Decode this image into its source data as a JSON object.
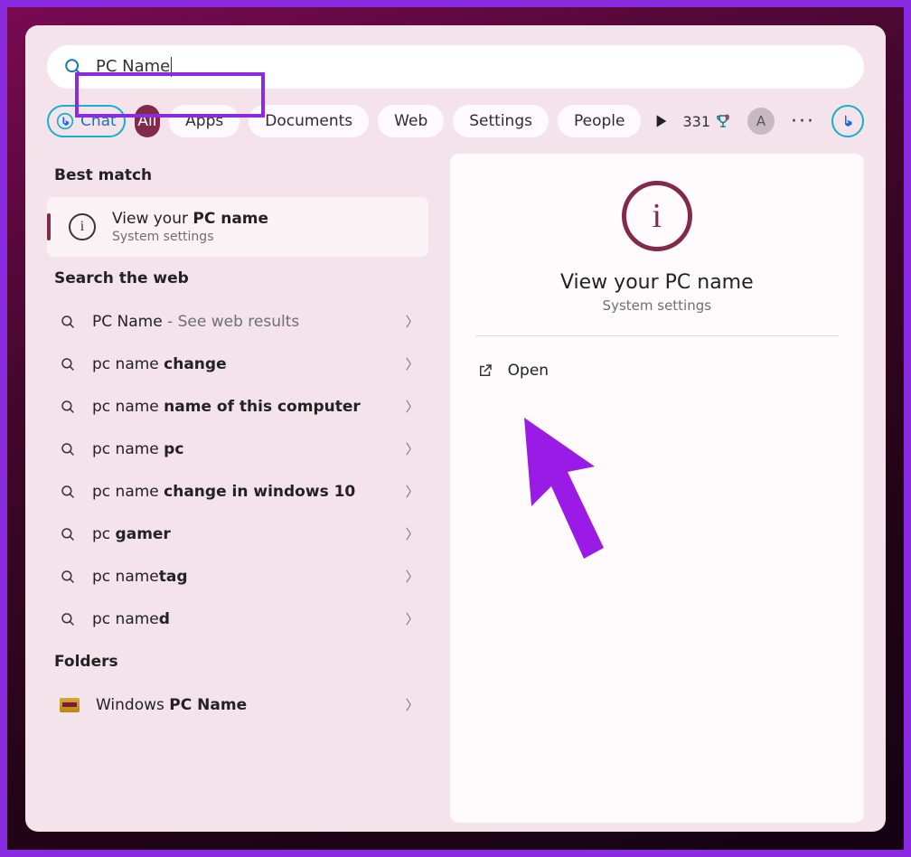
{
  "search": {
    "query": "PC Name"
  },
  "chips": {
    "chat": {
      "label": "Chat"
    },
    "all": {
      "label": "All"
    },
    "apps": {
      "label": "Apps"
    },
    "docs": {
      "label": "Documents"
    },
    "web": {
      "label": "Web"
    },
    "settings": {
      "label": "Settings"
    },
    "people": {
      "label": "People"
    }
  },
  "toolbar_right": {
    "score": "331",
    "avatar_initial": "A"
  },
  "left": {
    "best_match_label": "Best match",
    "best_match": {
      "title_pre": "View your ",
      "title_bold": "PC name",
      "subtitle": "System settings"
    },
    "search_web_label": "Search the web",
    "web_results": [
      {
        "pre": "PC Name",
        "bold": "",
        "suffix": " - See web results"
      },
      {
        "pre": "pc name ",
        "bold": "change",
        "suffix": ""
      },
      {
        "pre": "pc name ",
        "bold": "name of this computer",
        "suffix": ""
      },
      {
        "pre": "pc name ",
        "bold": "pc",
        "suffix": ""
      },
      {
        "pre": "pc name ",
        "bold": "change in windows 10",
        "suffix": ""
      },
      {
        "pre": "pc ",
        "bold": "gamer",
        "suffix": ""
      },
      {
        "pre": "pc name",
        "bold": "tag",
        "suffix": ""
      },
      {
        "pre": "pc name",
        "bold": "d",
        "suffix": ""
      }
    ],
    "folders_label": "Folders",
    "folders": [
      {
        "pre": "Windows ",
        "bold": "PC Name"
      }
    ]
  },
  "right_panel": {
    "title": "View your PC name",
    "subtitle": "System settings",
    "open_label": "Open"
  }
}
